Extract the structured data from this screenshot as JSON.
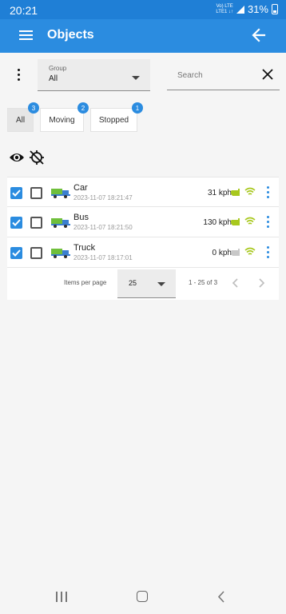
{
  "status_bar": {
    "time": "20:21",
    "network_top": "Vo) LTE",
    "network_bottom": "LTE1 ↓↑",
    "battery": "31%"
  },
  "app_bar": {
    "title": "Objects",
    "menu_icon": "hamburger-menu-icon",
    "back_icon": "arrow-back-icon"
  },
  "filter": {
    "group_label": "Group",
    "group_value": "All",
    "search_placeholder": "Search"
  },
  "tabs": [
    {
      "label": "All",
      "count": "3",
      "active": true
    },
    {
      "label": "Moving",
      "count": "2",
      "active": false
    },
    {
      "label": "Stopped",
      "count": "1",
      "active": false
    }
  ],
  "objects": [
    {
      "name": "Car",
      "time": "2023-11-07 18:21:47",
      "speed": "31 kph",
      "engine": "on"
    },
    {
      "name": "Bus",
      "time": "2023-11-07 18:21:50",
      "speed": "130 kph",
      "engine": "on"
    },
    {
      "name": "Truck",
      "time": "2023-11-07 18:17:01",
      "speed": "0 kph",
      "engine": "off"
    }
  ],
  "paginator": {
    "items_per_page_label": "Items per page",
    "page_size": "25",
    "range_label": "1 - 25 of 3"
  },
  "colors": {
    "primary": "#2b8ce0",
    "status_bar": "#1f7fd6",
    "engine_on": "#a8c81e",
    "engine_off": "#c8c8c8",
    "signal": "#a8c81e"
  }
}
